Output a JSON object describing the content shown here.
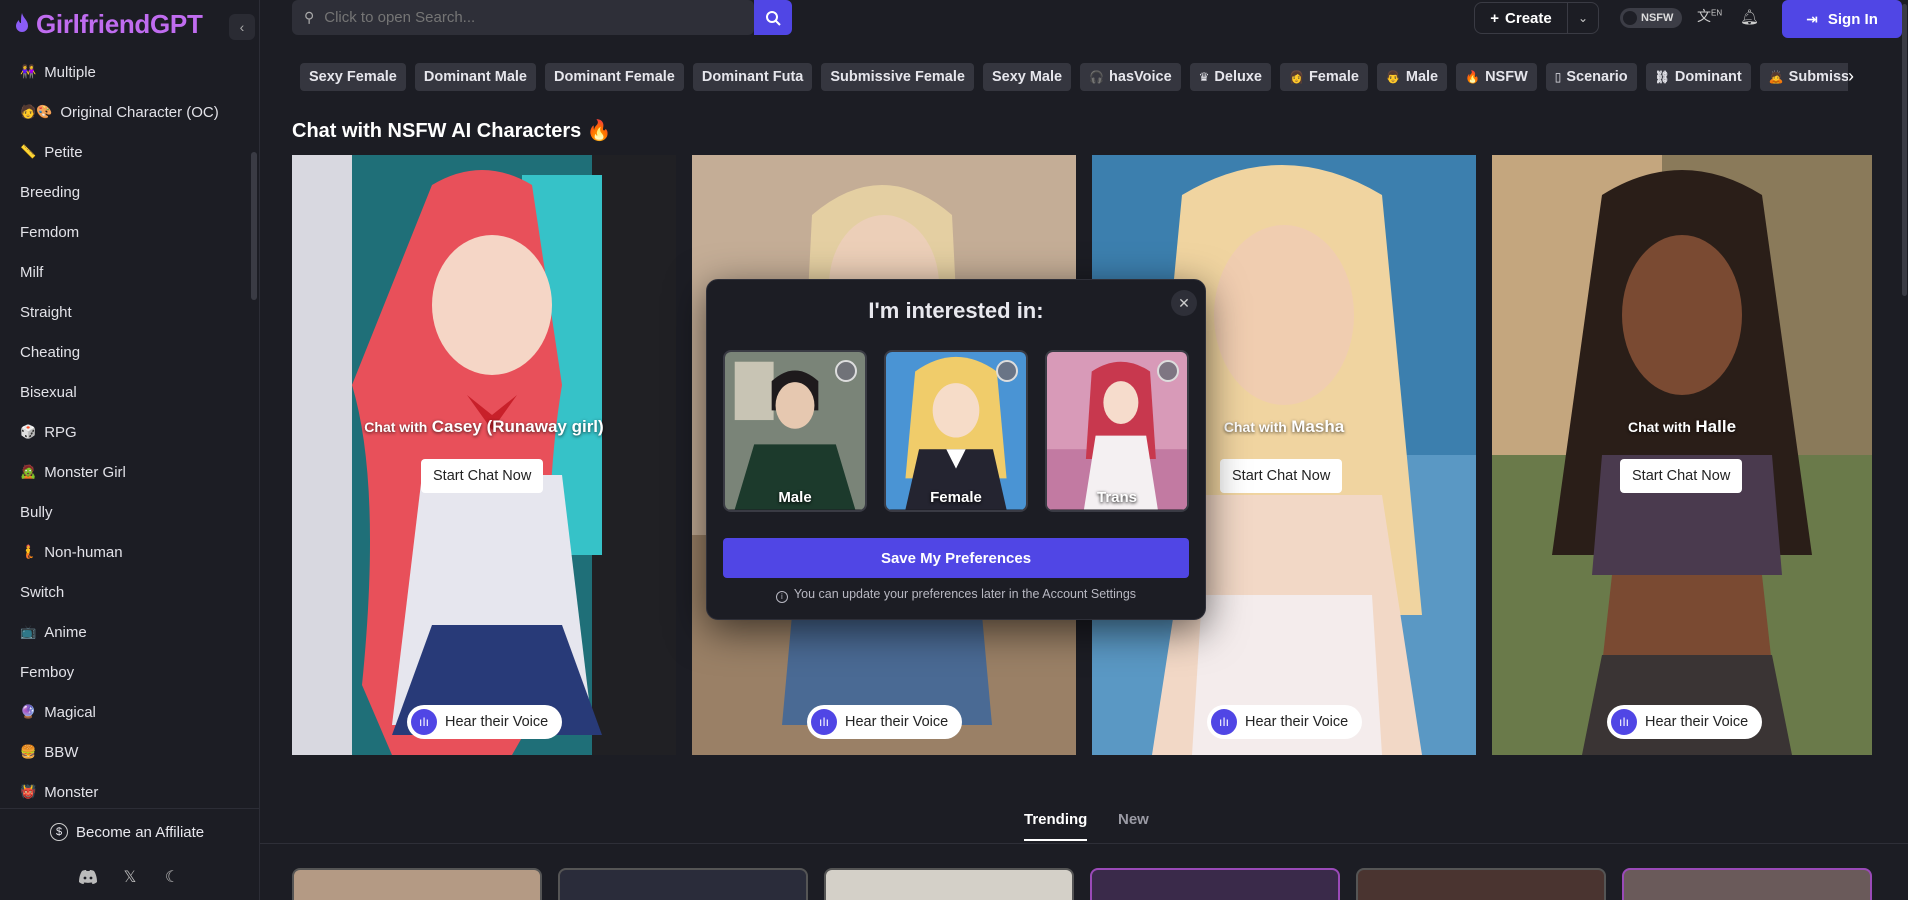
{
  "app": {
    "brand": "GirlfriendGPT"
  },
  "sidebar": {
    "items": [
      {
        "emoji": "👭",
        "label": "Multiple"
      },
      {
        "emoji": "🧑🎨",
        "label": "Original Character (OC)"
      },
      {
        "emoji": "📏",
        "label": "Petite"
      },
      {
        "emoji": "",
        "label": "Breeding"
      },
      {
        "emoji": "",
        "label": "Femdom"
      },
      {
        "emoji": "",
        "label": "Milf"
      },
      {
        "emoji": "",
        "label": "Straight"
      },
      {
        "emoji": "",
        "label": "Cheating"
      },
      {
        "emoji": "",
        "label": "Bisexual"
      },
      {
        "emoji": "🎲",
        "label": "RPG"
      },
      {
        "emoji": "🧟",
        "label": "Monster Girl"
      },
      {
        "emoji": "",
        "label": "Bully"
      },
      {
        "emoji": "🧜",
        "label": "Non-human"
      },
      {
        "emoji": "",
        "label": "Switch"
      },
      {
        "emoji": "📺",
        "label": "Anime"
      },
      {
        "emoji": "",
        "label": "Femboy"
      },
      {
        "emoji": "🔮",
        "label": "Magical"
      },
      {
        "emoji": "🍔",
        "label": "BBW"
      },
      {
        "emoji": "👹",
        "label": "Monster"
      }
    ],
    "affiliate_label": "Become an Affiliate"
  },
  "topbar": {
    "search_placeholder": "Click to open Search...",
    "create_label": "Create",
    "nsfw_label": "NSFW",
    "lang_label": "EN",
    "signin_label": "Sign In"
  },
  "tags": [
    {
      "emoji": "",
      "label": "Sexy Female"
    },
    {
      "emoji": "",
      "label": "Dominant Male"
    },
    {
      "emoji": "",
      "label": "Dominant Female"
    },
    {
      "emoji": "",
      "label": "Dominant Futa"
    },
    {
      "emoji": "",
      "label": "Submissive Female"
    },
    {
      "emoji": "",
      "label": "Sexy Male"
    },
    {
      "emoji": "🎧",
      "label": "hasVoice"
    },
    {
      "emoji": "♛",
      "label": "Deluxe"
    },
    {
      "emoji": "👩",
      "label": "Female"
    },
    {
      "emoji": "👨",
      "label": "Male"
    },
    {
      "emoji": "🔥",
      "label": "NSFW"
    },
    {
      "emoji": "▯",
      "label": "Scenario"
    },
    {
      "emoji": "⛓",
      "label": "Dominant"
    },
    {
      "emoji": "🙇",
      "label": "Submissive"
    }
  ],
  "main": {
    "heading": "Chat with NSFW AI Characters 🔥",
    "cards": [
      {
        "pre": "Chat with",
        "name": "Casey (Runaway girl)",
        "start": "Start Chat Now",
        "voice": "Hear their Voice"
      },
      {
        "pre": "",
        "name": "",
        "start": "",
        "voice": "Hear their Voice"
      },
      {
        "pre": "Chat with",
        "name": "Masha",
        "start": "Start Chat Now",
        "voice": "Hear their Voice"
      },
      {
        "pre": "Chat with",
        "name": "Halle",
        "start": "Start Chat Now",
        "voice": "Hear their Voice"
      }
    ],
    "tabs": [
      {
        "label": "Trending"
      },
      {
        "label": "New"
      }
    ]
  },
  "modal": {
    "title": "I'm interested in:",
    "options": [
      {
        "label": "Male"
      },
      {
        "label": "Female"
      },
      {
        "label": "Trans"
      }
    ],
    "save_label": "Save My Preferences",
    "note": "You can update your preferences later in the Account Settings"
  },
  "colors": {
    "accent": "#5046e5",
    "brand": "#c06cf0",
    "background": "#1c1d24"
  }
}
